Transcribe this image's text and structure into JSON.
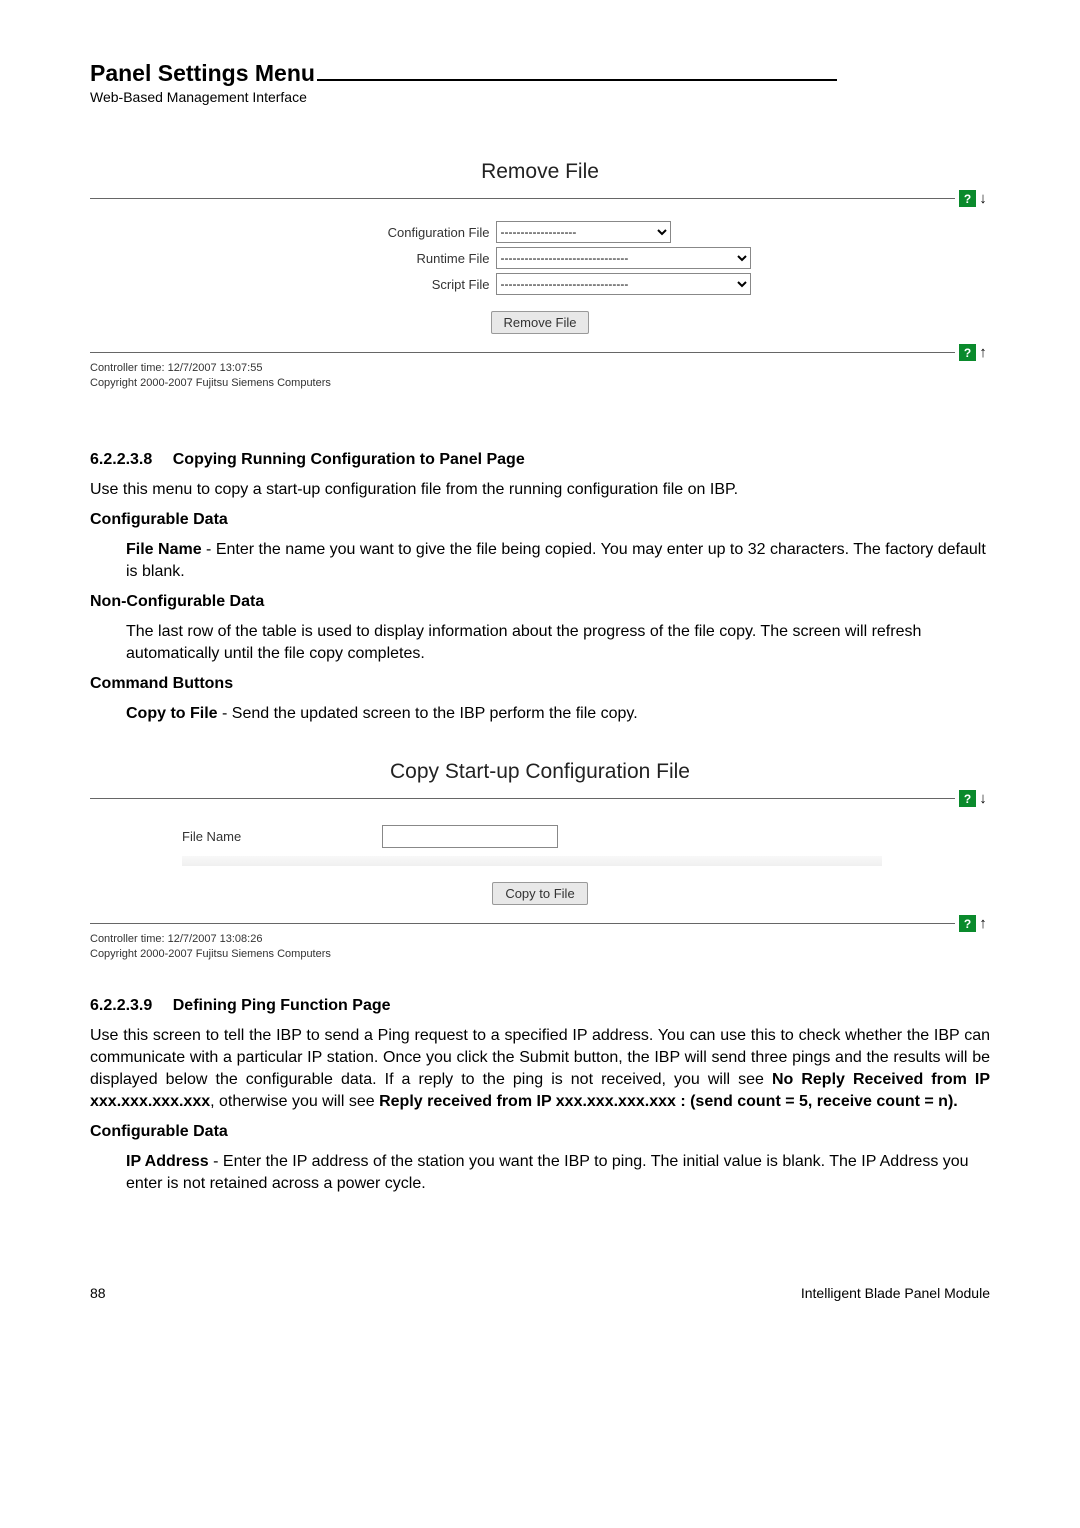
{
  "header": {
    "title": "Panel Settings Menu",
    "subtitle": "Web-Based Management Interface"
  },
  "remove_panel": {
    "title": "Remove File",
    "labels": {
      "config": "Configuration File",
      "runtime": "Runtime File",
      "script": "Script File"
    },
    "options": {
      "config": "-------------------",
      "runtime": "--------------------------------",
      "script": "--------------------------------"
    },
    "button": "Remove File",
    "controller_time": "Controller time: 12/7/2007 13:07:55",
    "copyright": "Copyright 2000-2007 Fujitsu Siemens Computers",
    "help": "?"
  },
  "section_638": {
    "number": "6.2.2.3.8",
    "title": "Copying Running Configuration to Panel Page",
    "intro": "Use this menu to copy a start-up configuration file from the running configuration file on IBP.",
    "cfg_data_head": "Configurable Data",
    "file_name_label": "File Name",
    "file_name_text": " - Enter the name you want to give the file being copied. You may enter up to 32 characters. The factory default is blank.",
    "noncfg_head": "Non-Configurable Data",
    "noncfg_text": "The last row of the table is used to display information about the progress of the file copy. The screen will refresh automatically until the file copy completes.",
    "cmd_head": "Command Buttons",
    "copy_label": "Copy to File",
    "copy_text": " - Send the updated screen to the IBP perform the file copy."
  },
  "copy_panel": {
    "title": "Copy Start-up Configuration File",
    "file_name_label": "File Name",
    "file_name_value": "",
    "button": "Copy to File",
    "controller_time": "Controller time: 12/7/2007 13:08:26",
    "copyright": "Copyright 2000-2007 Fujitsu Siemens Computers",
    "help": "?"
  },
  "section_639": {
    "number": "6.2.2.3.9",
    "title": "Defining Ping Function Page",
    "intro_pre": "Use this screen to tell the IBP to send a Ping request to a specified IP address. You can use this to check whether the IBP can communicate with a particular IP station. Once you click the Submit button, the IBP will send three pings and the results will be displayed below the configurable data. If a reply to the ping is not received, you will see ",
    "bold1": "No Reply Received from IP xxx.xxx.xxx.xxx",
    "mid": ", otherwise you will see ",
    "bold2": "Reply received from IP xxx.xxx.xxx.xxx : (send count = 5, receive count = n).",
    "cfg_data_head": "Configurable Data",
    "ip_label": "IP Address",
    "ip_text": " - Enter the IP address of the station you want the IBP to ping. The initial value is blank. The IP Address you enter is not retained across a power cycle."
  },
  "footer": {
    "page": "88",
    "right": "Intelligent Blade Panel Module"
  }
}
